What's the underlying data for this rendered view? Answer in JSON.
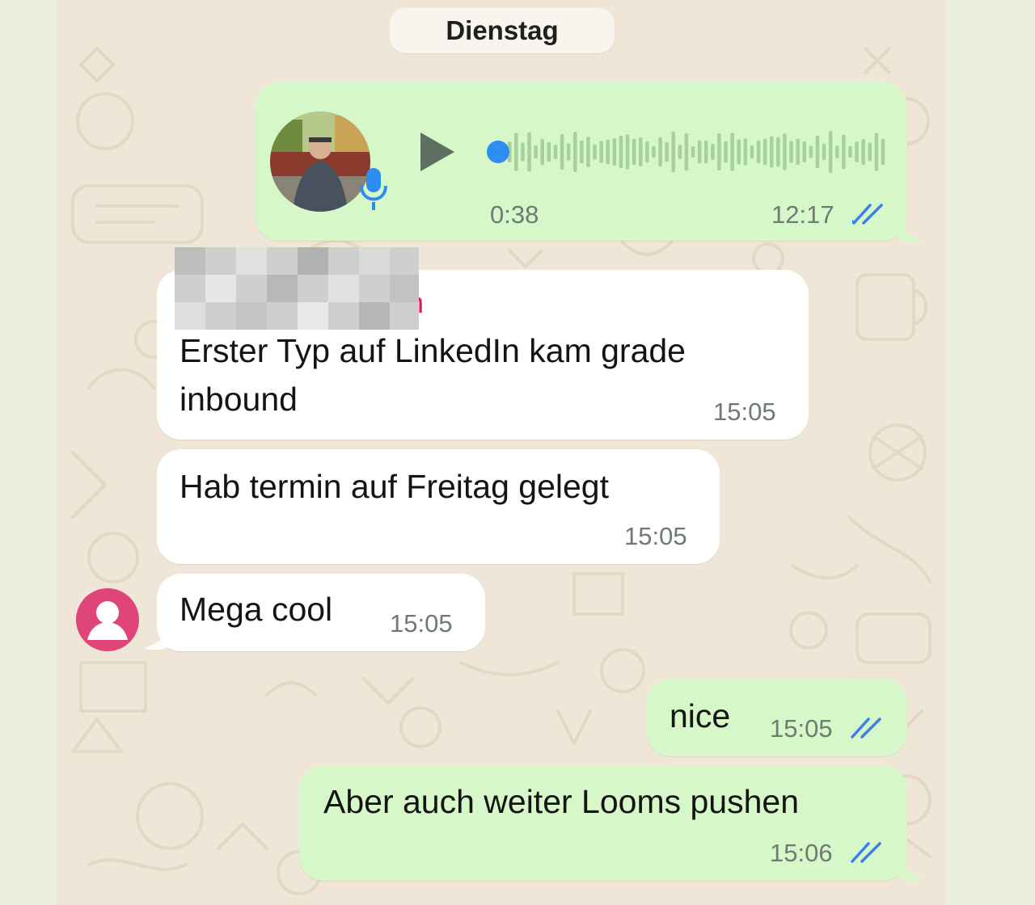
{
  "date_separator": "Dienstag",
  "colors": {
    "wallpaper": "#efe6d8",
    "outgoing_bubble": "#d6f8c9",
    "incoming_bubble": "#ffffff",
    "read_ticks": "#3b7ef0",
    "sender_name": "#d81b60",
    "avatar_pink": "#e0457a",
    "waveform": "#a7cfa0",
    "play_button": "#5f6f62",
    "mic": "#2f8df0"
  },
  "messages": [
    {
      "direction": "outgoing",
      "type": "voice",
      "duration": "0:38",
      "time": "12:17",
      "status_icon": "double-check-read-icon",
      "sender_photo": "profile-photo-man-outdoors"
    },
    {
      "direction": "incoming",
      "sender_name_visible_fragment": "n",
      "sender_name_redacted": true,
      "text_lines": [
        "Erster Typ auf LinkedIn kam grade",
        "inbound"
      ],
      "time": "15:05"
    },
    {
      "direction": "incoming",
      "text": "Hab termin auf Freitag gelegt",
      "time": "15:05"
    },
    {
      "direction": "incoming",
      "text": "Mega cool",
      "time": "15:05",
      "avatar_icon": "person-placeholder-icon"
    },
    {
      "direction": "outgoing",
      "text": "nice",
      "time": "15:05",
      "status_icon": "double-check-read-icon"
    },
    {
      "direction": "outgoing",
      "text": "Aber auch weiter Looms pushen",
      "time": "15:06",
      "status_icon": "double-check-read-icon"
    }
  ]
}
